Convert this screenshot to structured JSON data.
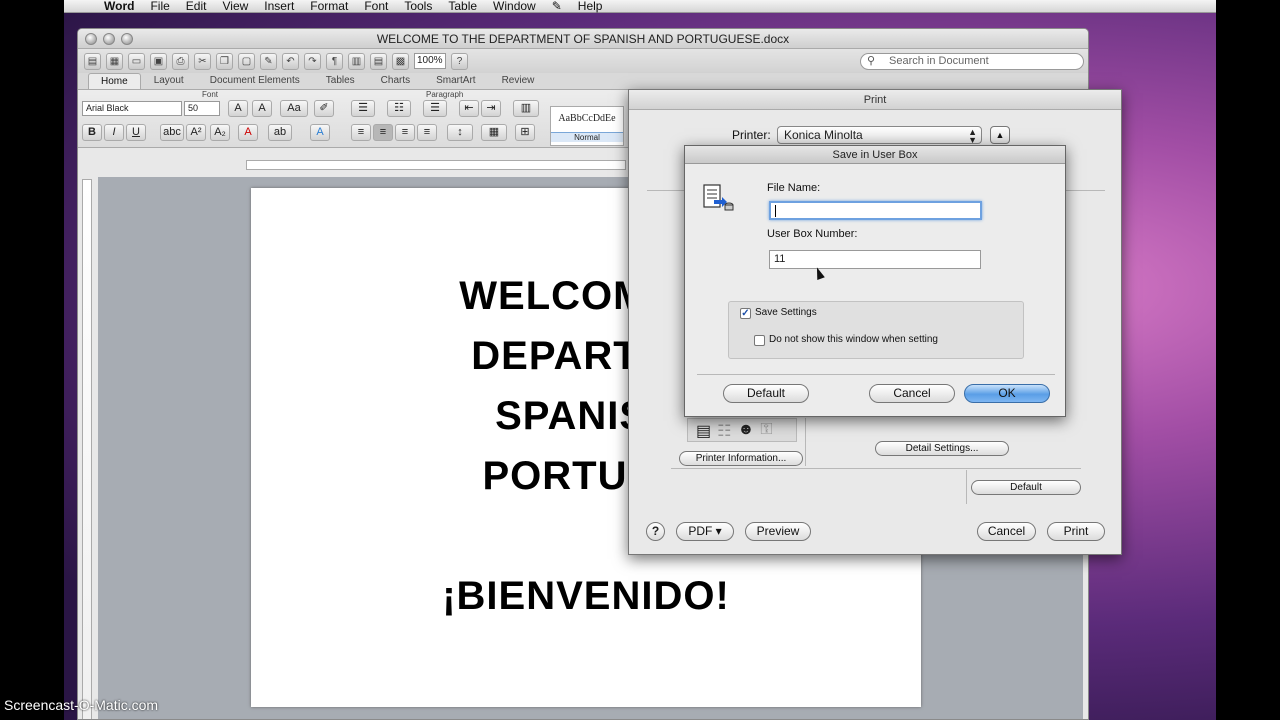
{
  "menubar": {
    "apple": "",
    "items": [
      "Word",
      "File",
      "Edit",
      "View",
      "Insert",
      "Format",
      "Font",
      "Tools",
      "Table",
      "Window",
      "",
      "Help"
    ]
  },
  "word": {
    "title": "WELCOME TO THE DEPARTMENT OF SPANISH AND PORTUGUESE.docx",
    "zoom": "100%",
    "search_placeholder": "Search in Document",
    "ribbon_tabs": [
      "Home",
      "Layout",
      "Document Elements",
      "Tables",
      "Charts",
      "SmartArt",
      "Review"
    ],
    "groups": {
      "font": "Font",
      "paragraph": "Paragraph"
    },
    "font_name": "Arial Black",
    "font_size": "50",
    "style_preview": "AaBbCcDdEe",
    "style_name": "Normal",
    "doc_lines": [
      "WELCOME T",
      "DEPARTME",
      "SPANISH",
      "PORTUGU",
      "¡BIENVENIDO!"
    ]
  },
  "print": {
    "title": "Print",
    "printer_label": "Printer:",
    "printer_value": "Konica Minolta",
    "printer_info": "Printer Information...",
    "detail_settings": "Detail Settings...",
    "default_small": "Default",
    "help": "?",
    "pdf": "PDF ▾",
    "preview": "Preview",
    "cancel": "Cancel",
    "print": "Print"
  },
  "userbox": {
    "title": "Save in User Box",
    "file_name_label": "File Name:",
    "file_name_value": "",
    "box_number_label": "User Box Number:",
    "box_number_value": "11",
    "save_settings": "Save Settings",
    "save_settings_checked": true,
    "dont_show": "Do not show this window when setting",
    "dont_show_checked": false,
    "default": "Default",
    "cancel": "Cancel",
    "ok": "OK"
  },
  "watermark": "Screencast-O-Matic.com"
}
